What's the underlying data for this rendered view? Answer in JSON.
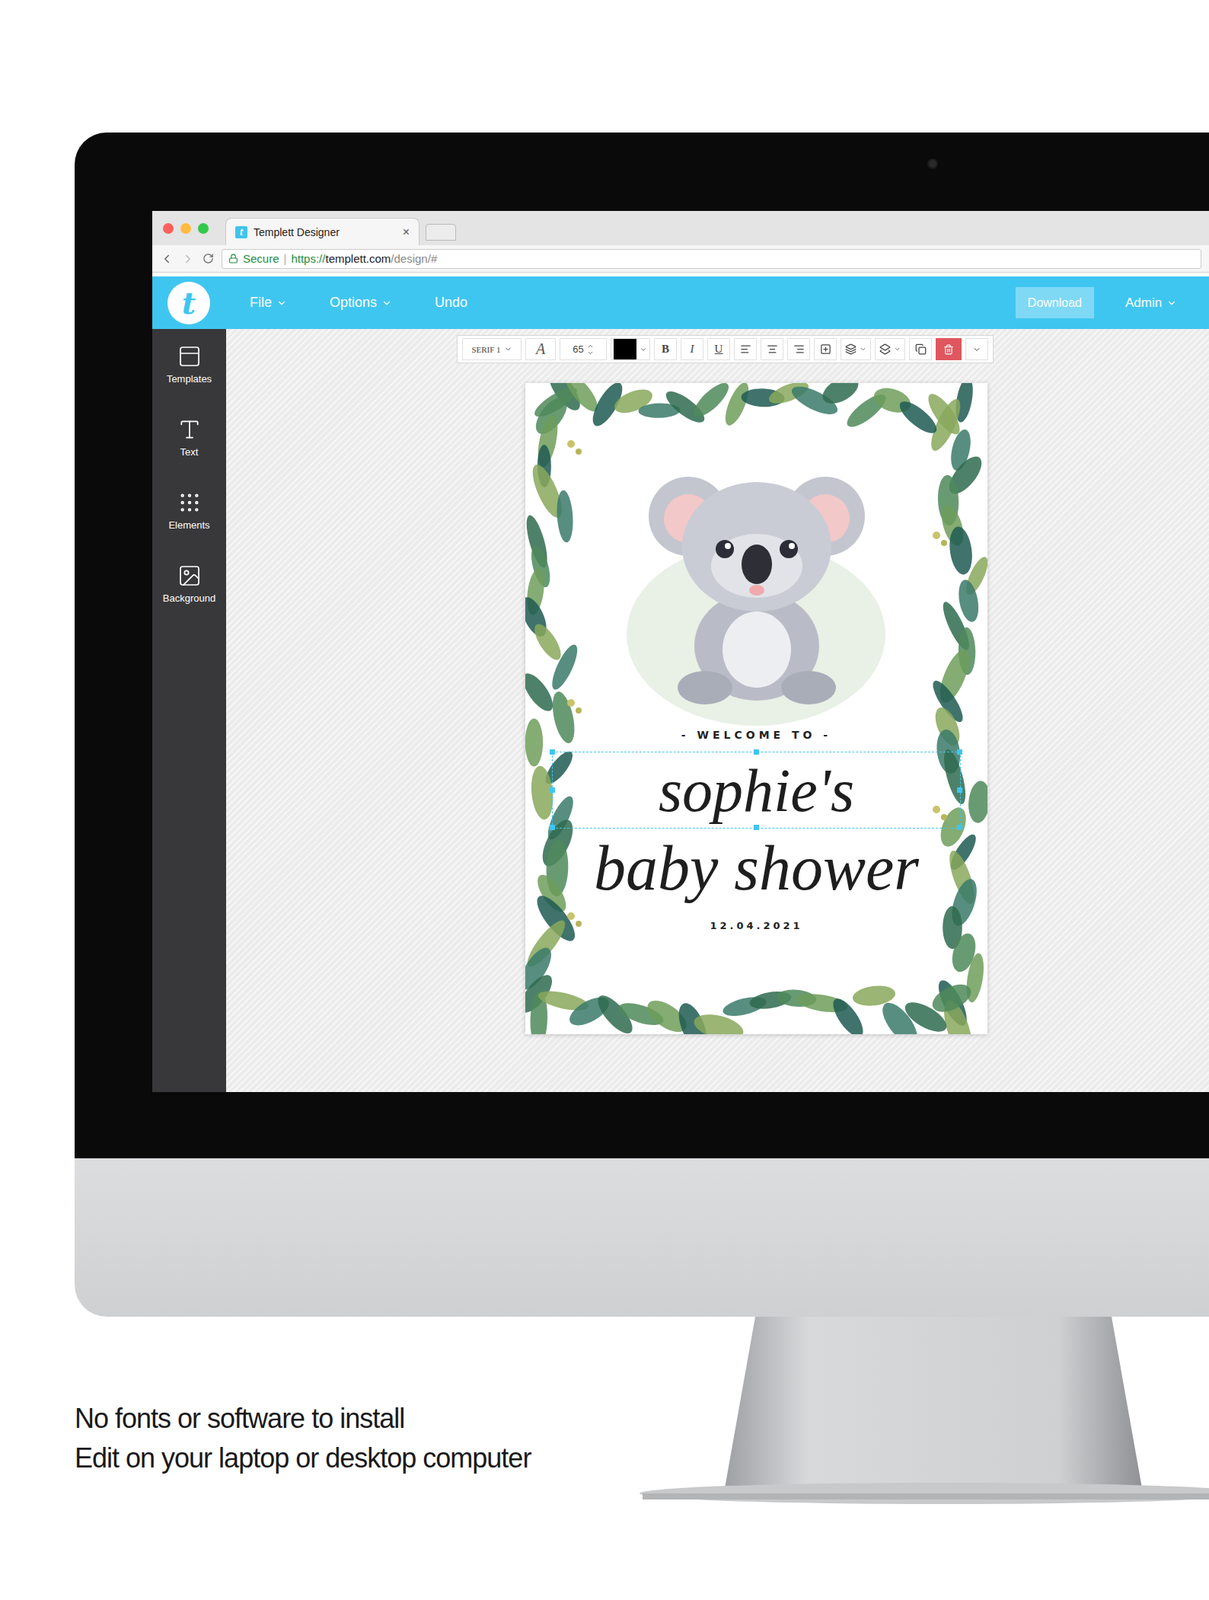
{
  "browser": {
    "tab": {
      "title": "Templett Designer",
      "close": "×"
    },
    "secure": "Secure",
    "separator": "|",
    "url": {
      "scheme": "https://",
      "host": "templett.com",
      "path": "/design/#"
    }
  },
  "app": {
    "logo": "t",
    "menu": [
      {
        "label": "File",
        "dropdown": true
      },
      {
        "label": "Options",
        "dropdown": true
      },
      {
        "label": "Undo",
        "dropdown": false
      }
    ],
    "download": "Download",
    "admin": "Admin"
  },
  "sidebar": {
    "items": [
      {
        "label": "Templates"
      },
      {
        "label": "Text"
      },
      {
        "label": "Elements"
      },
      {
        "label": "Background"
      }
    ]
  },
  "toolbar": {
    "font": "SERIF 1",
    "fontIcon": "A",
    "size": "65",
    "color": "#000000",
    "styles": [
      "B",
      "I",
      "U"
    ]
  },
  "design": {
    "welcome": "- WELCOME TO -",
    "name": "sophie's",
    "nameSelected": true,
    "event": "baby shower",
    "date": "12.04.2021"
  },
  "caption": [
    "No fonts or software to install",
    "Edit on your laptop or desktop computer"
  ]
}
